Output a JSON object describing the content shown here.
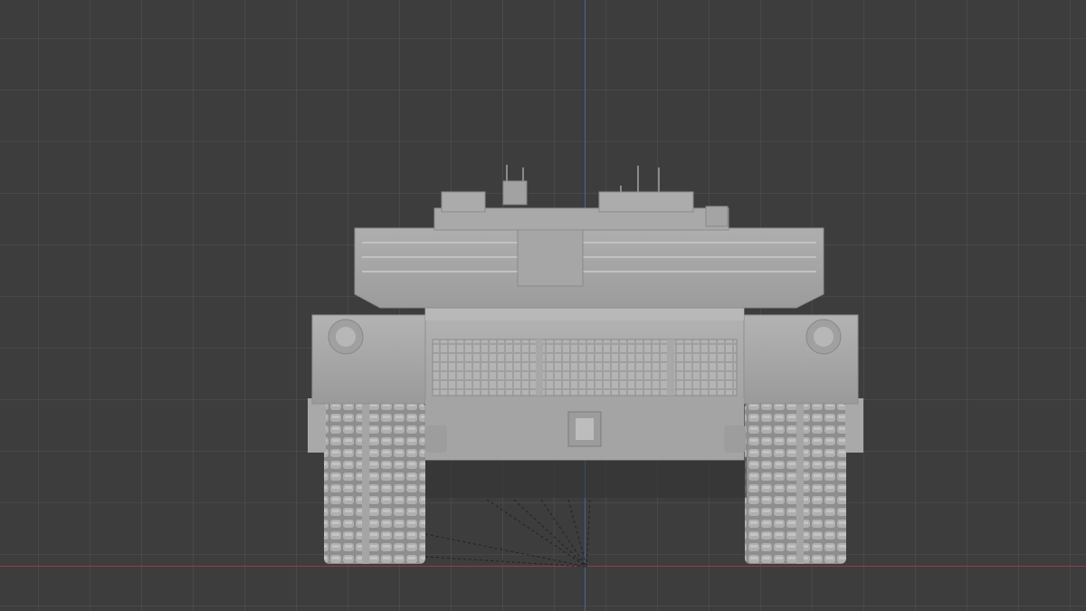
{
  "viewport": {
    "view": "front-orthographic",
    "background_color": "#3d3d3d",
    "grid_color": "#4a4a4a",
    "x_axis_color": "#9b3a46",
    "z_axis_color": "#3f6b93",
    "model_color": "#a8a8a8"
  },
  "model": {
    "kind": "main battle tank",
    "shading": "solid gray clay"
  }
}
